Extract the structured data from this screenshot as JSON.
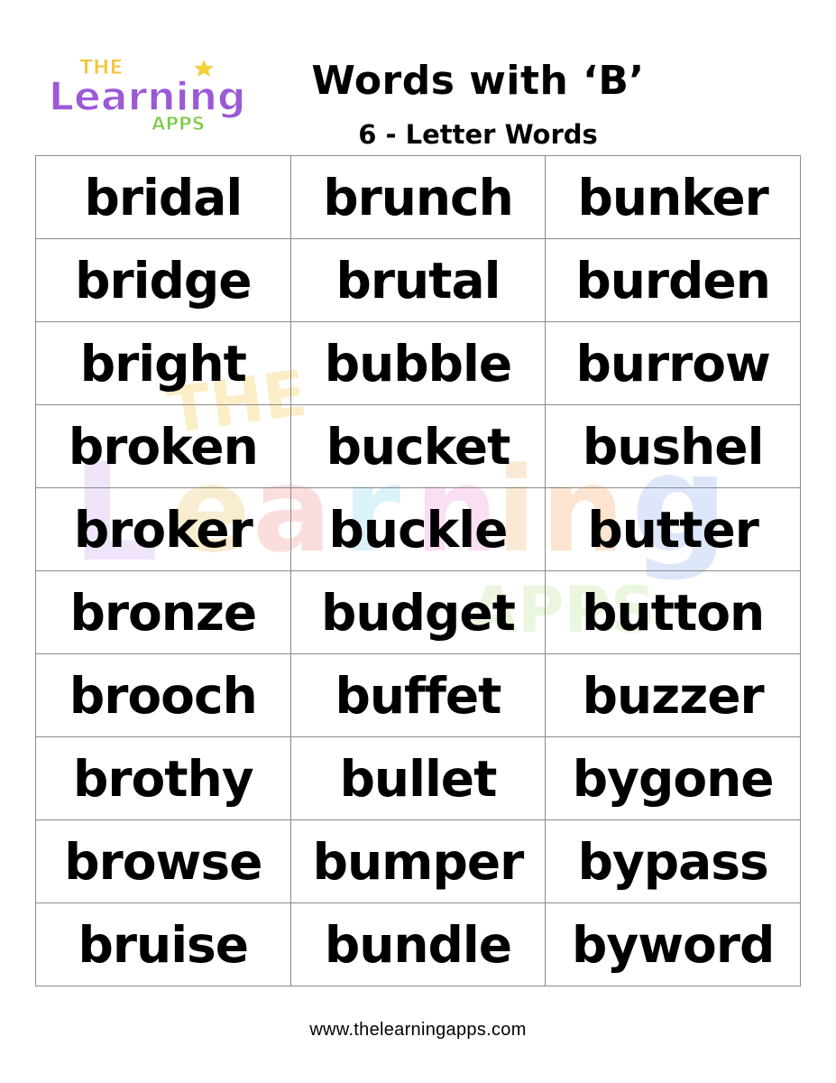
{
  "header": {
    "logo": {
      "line1": "THE",
      "line2": "Learning",
      "line3": "APPS",
      "colors": [
        "#9b59d6",
        "#e8a72a",
        "#e24a4a",
        "#3bb7e0",
        "#e84aa8",
        "#f08a2a",
        "#3a6fe8",
        "#7ac943",
        "#f4d23a"
      ]
    },
    "title": "Words with ‘B’",
    "subtitle": "6 - Letter Words"
  },
  "word_table": {
    "rows": [
      [
        "bridal",
        "brunch",
        "bunker"
      ],
      [
        "bridge",
        "brutal",
        "burden"
      ],
      [
        "bright",
        "bubble",
        "burrow"
      ],
      [
        "broken",
        "bucket",
        "bushel"
      ],
      [
        "broker",
        "buckle",
        "butter"
      ],
      [
        "bronze",
        "budget",
        "button"
      ],
      [
        "brooch",
        "buffet",
        "buzzer"
      ],
      [
        "brothy",
        "bullet",
        "bygone"
      ],
      [
        "browse",
        "bumper",
        "bypass"
      ],
      [
        "bruise",
        "bundle",
        "byword"
      ]
    ]
  },
  "footer": {
    "website": "www.thelearningapps.com"
  }
}
